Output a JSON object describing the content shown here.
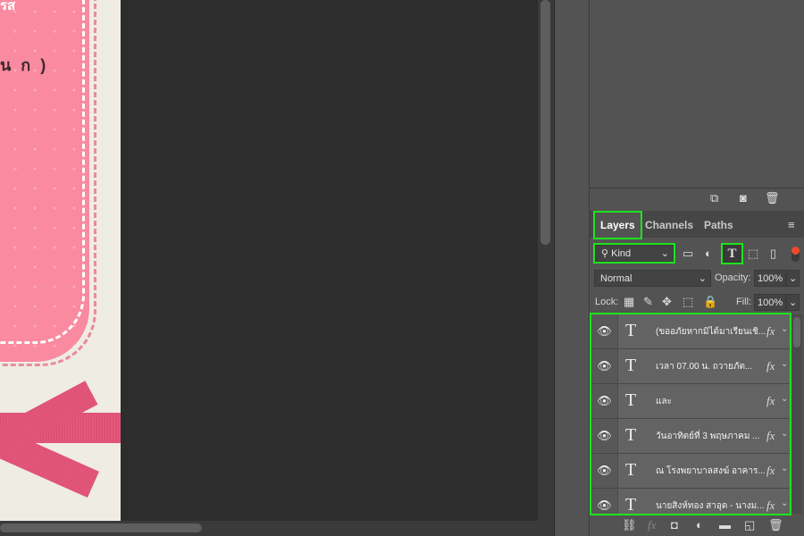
{
  "artwork": {
    "text_top": "รส",
    "text_mid": "น ก )"
  },
  "panel": {
    "top_icons": [
      "new-snapshot-icon",
      "camera-icon",
      "trash-icon"
    ],
    "tabs": [
      {
        "label": "Layers",
        "active": true
      },
      {
        "label": "Channels"
      },
      {
        "label": "Paths"
      }
    ],
    "filter": {
      "label": "Kind",
      "filter_icons": [
        "image-filter-icon",
        "adjustment-filter-icon",
        "type-filter-icon",
        "shape-filter-icon",
        "smart-object-filter-icon"
      ],
      "active_filter": "type-filter-icon"
    },
    "blend_mode": "Normal",
    "opacity_label": "Opacity:",
    "opacity": "100%",
    "lock_label": "Lock:",
    "fill_label": "Fill:",
    "fill": "100%",
    "layers": [
      {
        "name": "(ขออภัยหากมิได้มาเรียนเชิ...",
        "fx": "fx"
      },
      {
        "name": "เวลา 07.00  น.   ถวายภัต...",
        "fx": "fx"
      },
      {
        "name": "และ",
        "fx": "fx"
      },
      {
        "name": " วันอาทิตย์ที่ 3 พฤษภาคม  ...",
        "fx": "fx"
      },
      {
        "name": "ณ โรงพยาบาลสงฆ์  อาคาร...",
        "fx": "fx"
      },
      {
        "name": "นายสิงห์ทอง  สาอุด - นางม...",
        "fx": "fx"
      }
    ],
    "highlight_color": "#1ee31e",
    "bottom_icons": [
      "link-icon",
      "fx-icon",
      "mask-icon",
      "adjustment-icon",
      "group-folder-icon",
      "new-layer-icon",
      "trash-icon"
    ]
  }
}
